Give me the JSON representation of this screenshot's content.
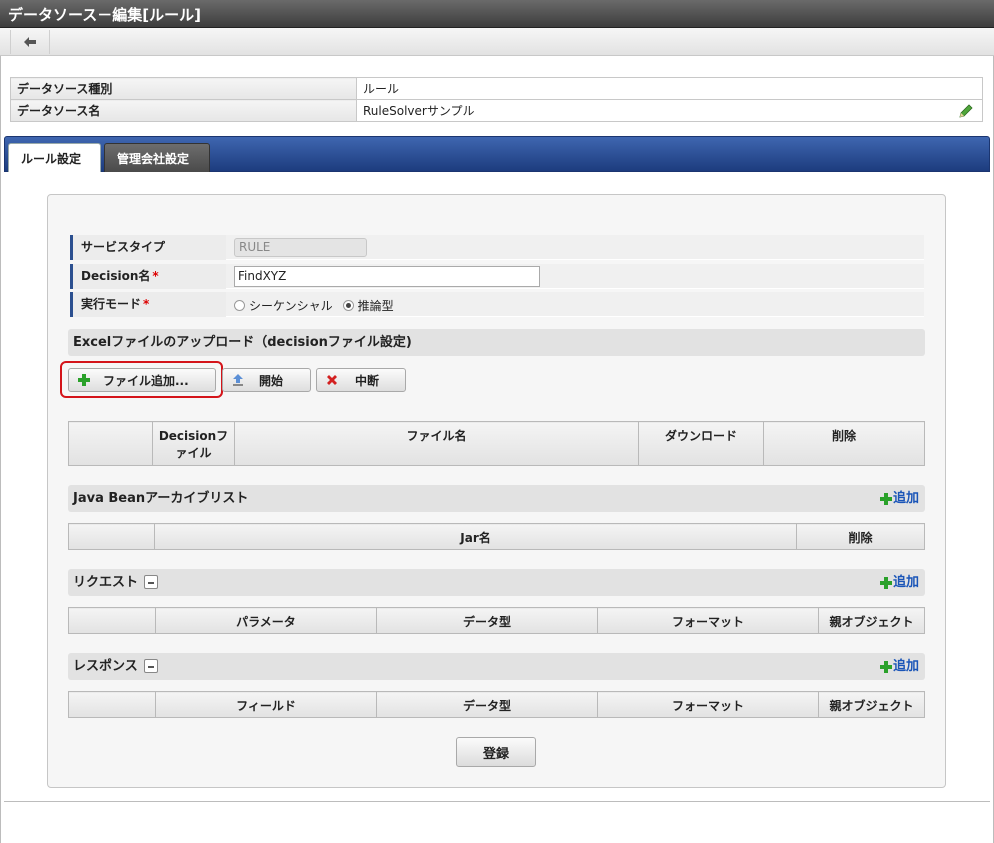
{
  "window": {
    "title": "データソース－編集[ルール]"
  },
  "info": {
    "rows": [
      {
        "label": "データソース種別",
        "value": "ルール"
      },
      {
        "label": "データソース名",
        "value": "RuleSolverサンプル"
      }
    ]
  },
  "tabs": [
    {
      "label": "ルール設定",
      "active": true
    },
    {
      "label": "管理会社設定",
      "active": false
    }
  ],
  "form": {
    "service_type": {
      "label": "サービスタイプ",
      "value": "RULE"
    },
    "decision_name": {
      "label": "Decision名",
      "required_mark": "*",
      "value": "FindXYZ"
    },
    "exec_mode": {
      "label": "実行モード",
      "required_mark": "*",
      "options": [
        "シーケンシャル",
        "推論型"
      ],
      "selected": "推論型"
    }
  },
  "excel_upload": {
    "heading": "Excelファイルのアップロード（decisionファイル設定)",
    "buttons": {
      "add_file": "ファイル追加...",
      "start": "開始",
      "stop": "中断"
    },
    "columns": [
      "",
      "Decisionファイル",
      "ファイル名",
      "ダウンロード",
      "削除"
    ]
  },
  "java_bean": {
    "heading": "Java Beanアーカイブリスト",
    "add_label": "追加",
    "columns": [
      "",
      "Jar名",
      "削除"
    ]
  },
  "request": {
    "heading": "リクエスト",
    "add_label": "追加",
    "columns": [
      "",
      "パラメータ",
      "データ型",
      "フォーマット",
      "親オブジェクト"
    ]
  },
  "response": {
    "heading": "レスポンス",
    "add_label": "追加",
    "columns": [
      "",
      "フィールド",
      "データ型",
      "フォーマット",
      "親オブジェクト"
    ]
  },
  "footer": {
    "submit_label": "登録"
  },
  "colors": {
    "tab_bar": "#2b4f9a",
    "highlight": "#d4141a",
    "link": "#1a55b8",
    "add_icon": "#2aa12a"
  }
}
